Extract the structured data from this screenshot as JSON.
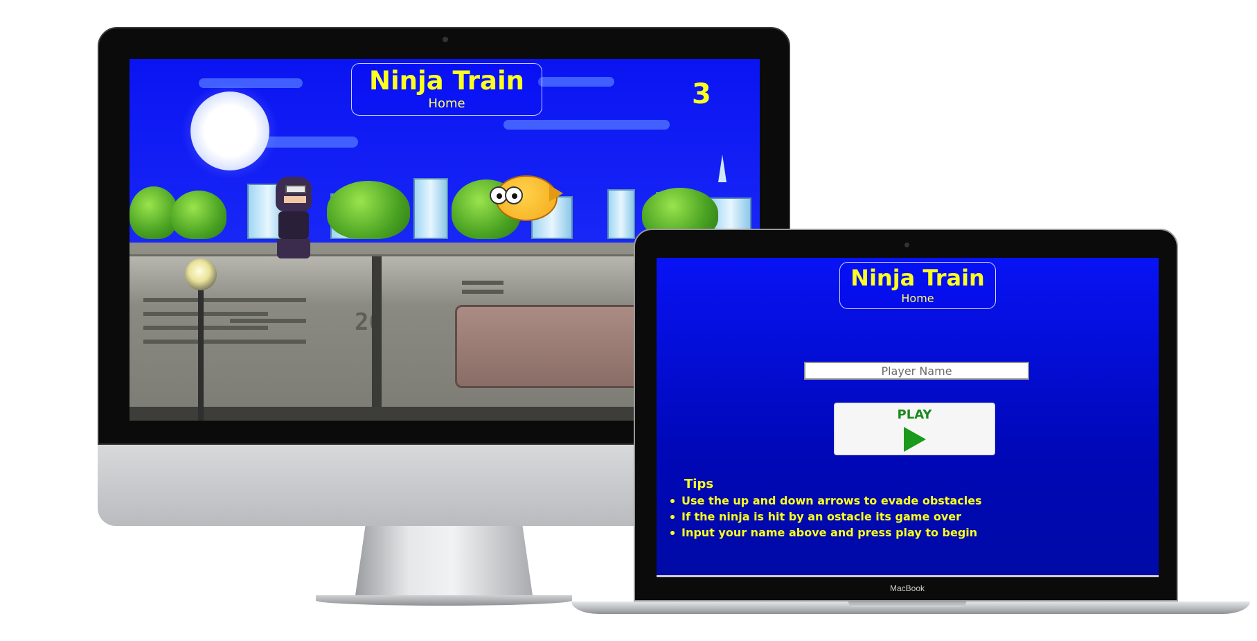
{
  "desktop": {
    "title": "Ninja Train",
    "nav_home": "Home",
    "score": "3",
    "car_number": "26"
  },
  "laptop": {
    "title": "Ninja Train",
    "nav_home": "Home",
    "player_name_placeholder": "Player Name",
    "play_label": "PLAY",
    "play_icon": "play-triangle-icon",
    "tips_title": "Tips",
    "tips": [
      "Use the up and down arrows to evade obstacles",
      "If the ninja is hit by an ostacle its game over",
      "Input your name above and press play to begin"
    ],
    "device_label": "MacBook"
  },
  "colors": {
    "title_yellow": "#fbff1f",
    "background_blue": "#0813f5",
    "play_green": "#1a9a1a"
  }
}
